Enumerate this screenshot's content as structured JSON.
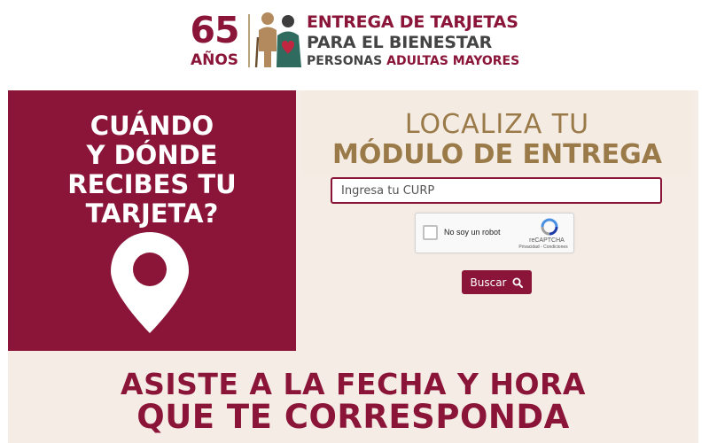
{
  "header": {
    "logo_number": "65",
    "logo_years": "AÑOS",
    "title_line1": "ENTREGA DE TARJETAS",
    "title_line2": "PARA EL BIENESTAR",
    "title_line3_a": "PERSONAS",
    "title_line3_b": "ADULTAS MAYORES"
  },
  "left_panel": {
    "line1": "CUÁNDO",
    "line2": "Y DÓNDE",
    "line3": "RECIBES TU",
    "line4": "TARJETA?",
    "icon": "map-pin-icon"
  },
  "locator": {
    "title_line1": "LOCALIZA TU",
    "title_line2": "MÓDULO DE ENTREGA",
    "curp_placeholder": "Ingresa tu CURP",
    "curp_value": ""
  },
  "recaptcha": {
    "label": "No soy un robot",
    "brand": "reCAPTCHA",
    "links": "Privacidad - Condiciones"
  },
  "search_button": {
    "label": "Buscar",
    "icon": "search-icon"
  },
  "footer_banner": {
    "line1": "ASISTE A LA FECHA Y HORA",
    "line2": "QUE TE CORRESPONDA"
  },
  "colors": {
    "primary": "#8a1538",
    "gold": "#9a7a48",
    "background": "#f6ece6"
  }
}
